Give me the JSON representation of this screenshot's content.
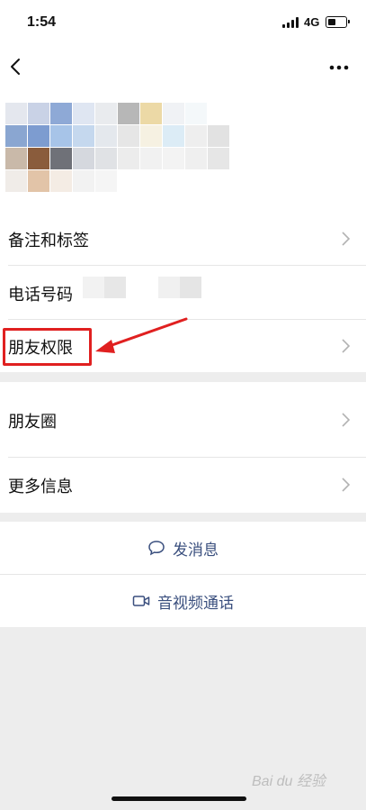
{
  "status_bar": {
    "time": "1:54",
    "network": "4G"
  },
  "nav": {
    "back_icon": "chevron-left-icon",
    "more_icon": "more-dots-icon"
  },
  "menu": {
    "remarks_tags": "备注和标签",
    "phone_label": "电话号码",
    "friend_permissions": "朋友权限",
    "moments": "朋友圈",
    "more_info": "更多信息"
  },
  "actions": {
    "send_message": "发消息",
    "av_call": "音视频通话"
  },
  "watermark": "Bai du 经验",
  "colors": {
    "accent_text": "#3a4f7e",
    "annotation_red": "#e02020",
    "background": "#ededed"
  }
}
